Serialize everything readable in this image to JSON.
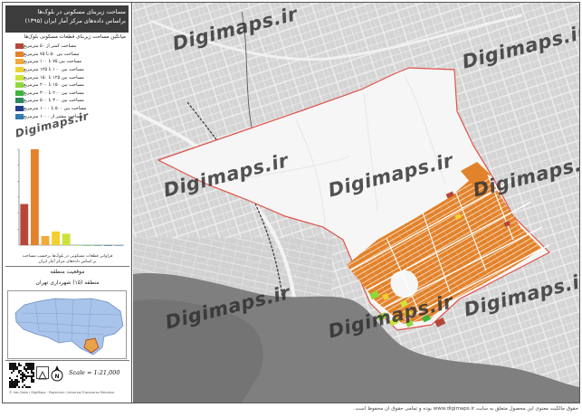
{
  "panel": {
    "title_line1": "مساحت زیربنای مسکونی در بلوک‌ها",
    "title_line2": "براساس داده‌های مرکز آمار ایران (۱۳۹۵)"
  },
  "legend": {
    "title": "میانگین مساحت زیربنای قطعات مسکونی بلوک‌ها",
    "items": [
      {
        "label": "مساحت کمتر از ۵۰ مترمربع",
        "color": "#b5473a"
      },
      {
        "label": "مساحت بین ۵۰ تا ۷۵ مترمربع",
        "color": "#e2822a"
      },
      {
        "label": "مساحت بین ۷۵ تا ۱۰۰ مترمربع",
        "color": "#f0a93a"
      },
      {
        "label": "مساحت بین ۱۰۰ تا ۱۲۵ مترمربع",
        "color": "#f2d02e"
      },
      {
        "label": "مساحت بین ۱۲۵ تا ۱۵۰ مترمربع",
        "color": "#cfe23a"
      },
      {
        "label": "مساحت بین ۱۵۰ تا ۲۰۰ مترمربع",
        "color": "#8fd93a"
      },
      {
        "label": "مساحت بین ۲۰۰ تا ۳۰۰ مترمربع",
        "color": "#3fb43a"
      },
      {
        "label": "مساحت بین ۳۰۰ تا ۵۰۰ مترمربع",
        "color": "#2a8a5a"
      },
      {
        "label": "مساحت بین ۵۰۰ تا ۱۰۰۰ مترمربع",
        "color": "#1f3f8a"
      },
      {
        "label": "مساحت بیشتر از ۱۰۰۰ مترمربع",
        "color": "#2f7ab0"
      }
    ]
  },
  "chart_data": {
    "type": "bar",
    "categories": [
      "<50",
      "50-75",
      "75-100",
      "100-125",
      "125-150",
      "150-200",
      "200-300",
      "300-500",
      "500-1000",
      ">1000"
    ],
    "values": [
      18,
      42,
      4,
      6,
      5,
      0,
      0,
      0,
      0,
      0
    ],
    "colors": [
      "#b5473a",
      "#e2822a",
      "#f0a93a",
      "#f2d02e",
      "#cfe23a",
      "#8fd93a",
      "#3fb43a",
      "#2a8a5a",
      "#1f3f8a",
      "#2f7ab0"
    ],
    "caption_line1": "فراوانی قطعات مسکونی در بلوک‌ها برحسب مساحت",
    "caption_line2": "بر اساس داده‌های مرکز آمار ایران"
  },
  "location": {
    "title": "موقعیت منطقه",
    "district": "منطقه (۱۵) شهرداری تهران"
  },
  "scale": {
    "text": "Scale = 1:21,000"
  },
  "north": {
    "letter": "N"
  },
  "credit": "© Iran Data / DigiMaps · Projection: Universal Transverse Mercator",
  "watermarks": {
    "text": "Digimaps.ir"
  },
  "footer": {
    "text": "حقوق مالکیت معنوی این محصول متعلق به سایت www.digimaps.ir بوده و تمامی حقوق آن محفوظ است."
  },
  "colors": {
    "boundary": "#e0524a",
    "orange": "#e2822a",
    "water": "#7f7f7f",
    "background": "#d4d4d4"
  }
}
